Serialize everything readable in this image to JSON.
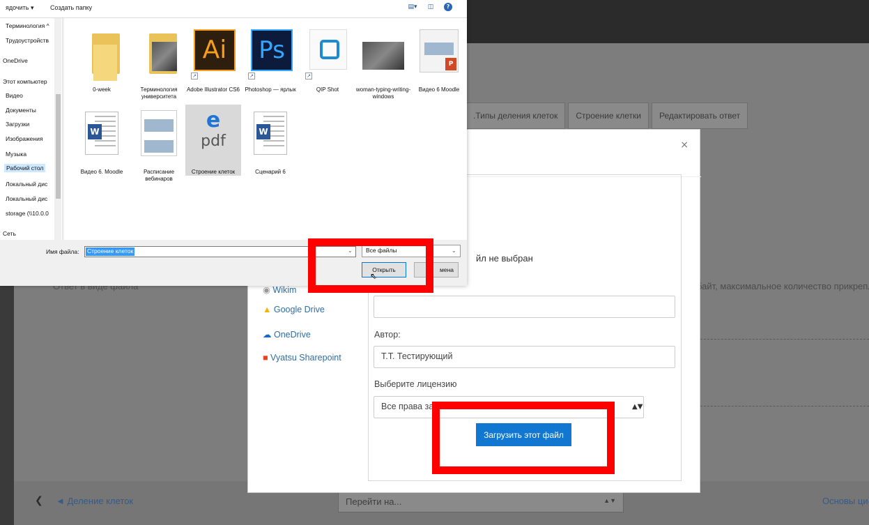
{
  "background_page": {
    "tabs": [
      ".Типы деления клеток",
      "Строение клетки",
      "Редактировать ответ"
    ],
    "answer_label": "Ответ в виде файла",
    "max_files_text": "байт, максимальное количество прикрепле",
    "prev_link": "◄ Деление клеток",
    "prev_arrow": "❮",
    "jump_select": "Перейти на...",
    "next_link": "Основы ци"
  },
  "file_picker": {
    "close": "×",
    "repositories": [
      "Wikim",
      "Google Drive",
      "OneDrive",
      "Vyatsu Sharepoint"
    ],
    "file_not_chosen": "йл не выбран",
    "author_label": "Автор:",
    "author_value": "Т.Т. Тестирующий",
    "license_label": "Выберите лицензию",
    "license_value": "Все права за",
    "upload_button": "Загрузить этот файл"
  },
  "windows_dialog": {
    "toolbar": {
      "organize": "ядочить ▾",
      "new_folder": "Создать папку",
      "help": "?"
    },
    "nav_items": [
      "Терминология ^",
      "Трудоустройств",
      "OneDrive",
      "Этот компьютер",
      "Видео",
      "Документы",
      "Загрузки",
      "Изображения",
      "Музыка",
      "Рабочий стол",
      "Локальный дис",
      "Локальный дис",
      "storage (\\\\10.0.0",
      "Сеть"
    ],
    "files": [
      {
        "label": "0-week",
        "kind": "folder"
      },
      {
        "label": "Терминология университета",
        "kind": "folder-photo"
      },
      {
        "label": "Adobe Illustrator CS6",
        "kind": "ai"
      },
      {
        "label": "Photoshop — ярлык",
        "kind": "ps"
      },
      {
        "label": "QIP Shot",
        "kind": "qip"
      },
      {
        "label": "woman-typing-writing-windows",
        "kind": "photo"
      },
      {
        "label": "Видео 6 Moodle",
        "kind": "ppt"
      },
      {
        "label": "Видео 6. Moodle",
        "kind": "word"
      },
      {
        "label": "Расписание вебинаров",
        "kind": "schedule"
      },
      {
        "label": "Строение клеток",
        "kind": "pdf"
      },
      {
        "label": "Сценарий 6",
        "kind": "word"
      }
    ],
    "filename_label": "Имя файла:",
    "filename_value": "Строение клеток",
    "filetype": "Все файлы",
    "open_button": "Открыть",
    "cancel_button": "мена"
  },
  "highlight_color": "#ff0000",
  "accent_color": "#1177d1"
}
